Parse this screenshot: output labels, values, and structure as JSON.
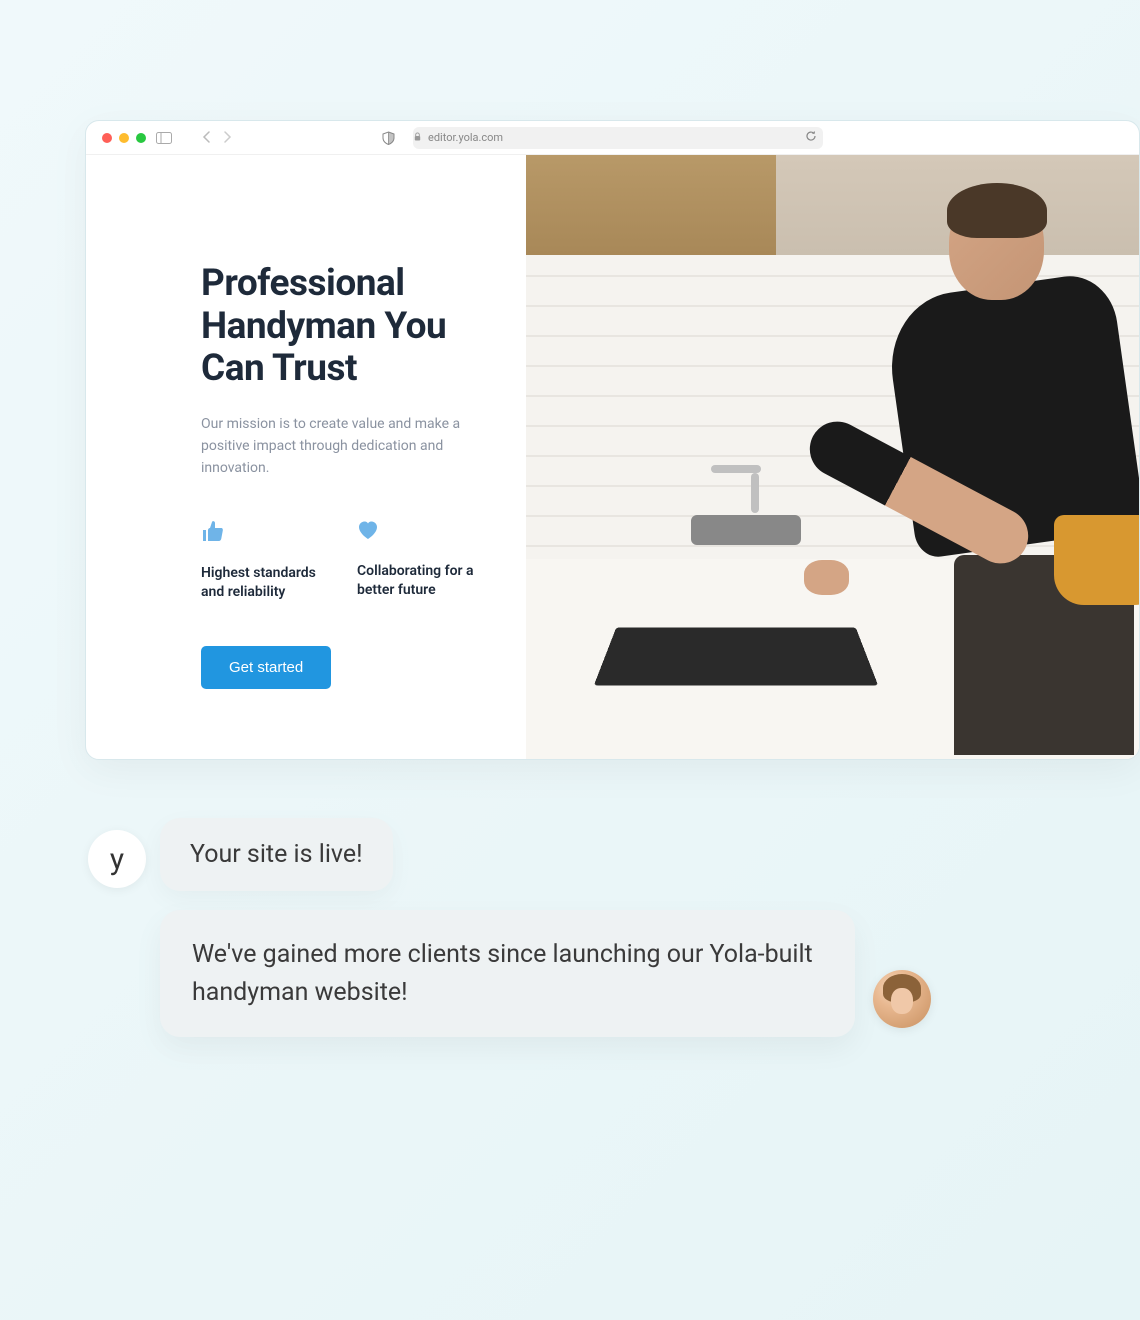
{
  "browser": {
    "url": "editor.yola.com"
  },
  "hero": {
    "title": "Professional Handyman You Can Trust",
    "subtitle": "Our mission is to create value and make a positive impact through dedication and innovation.",
    "cta_label": "Get started"
  },
  "features": [
    {
      "icon": "thumb-up",
      "text": "Highest standards and reliability"
    },
    {
      "icon": "heart",
      "text": "Collaborating for a better future"
    }
  ],
  "chat": {
    "bot_avatar_letter": "y",
    "message1": "Your site is live!",
    "message2": "We've gained more clients since launching our Yola-built handyman website!"
  },
  "colors": {
    "accent": "#2196e0",
    "icon_blue": "#6fb4e8"
  }
}
